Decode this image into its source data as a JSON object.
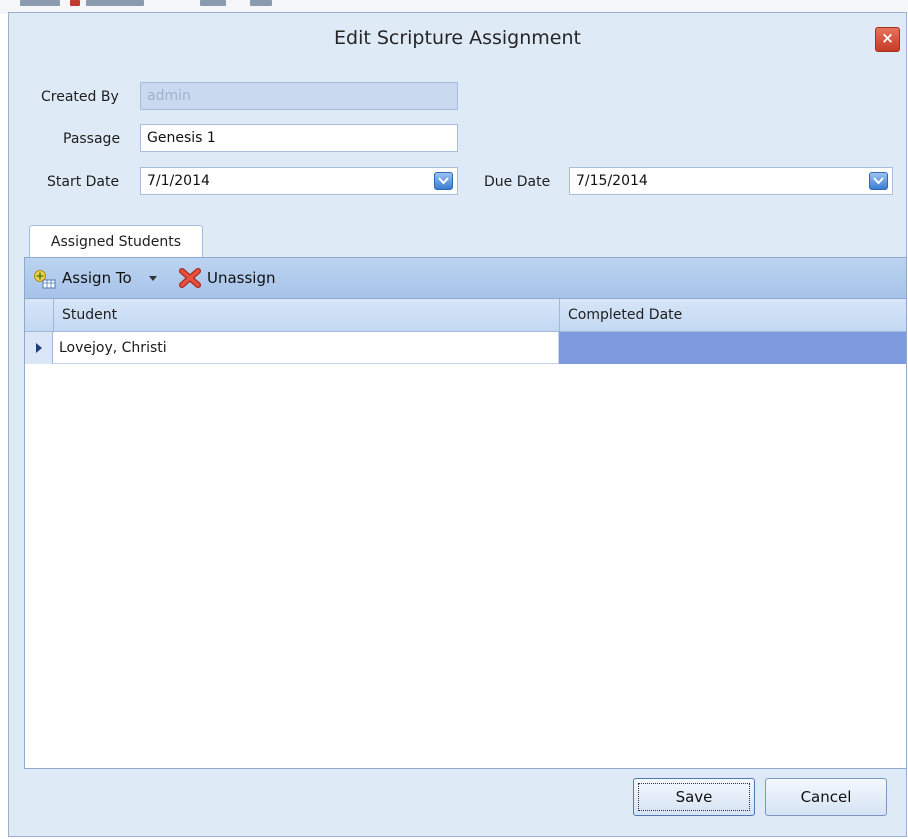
{
  "window": {
    "title": "Edit Scripture Assignment",
    "close_label": "×"
  },
  "form": {
    "created_by": {
      "label": "Created By",
      "value": "admin"
    },
    "passage": {
      "label": "Passage",
      "value": "Genesis 1"
    },
    "start_date": {
      "label": "Start Date",
      "value": "7/1/2014"
    },
    "due_date": {
      "label": "Due Date",
      "value": "7/15/2014"
    }
  },
  "tabs": [
    {
      "label": "Assigned Students",
      "active": true
    }
  ],
  "toolbar": {
    "assign_label": "Assign To",
    "unassign_label": "Unassign"
  },
  "grid": {
    "columns": [
      "Student",
      "Completed Date"
    ],
    "rows": [
      {
        "student": "Lovejoy, Christi",
        "completed_date": ""
      }
    ]
  },
  "buttons": {
    "save_label": "Save",
    "cancel_label": "Cancel"
  },
  "colors": {
    "dialog_bg": "#dfeaf7",
    "selected_cell": "#7f9be0",
    "close_button": "#d9533c",
    "header_bg": "#c3d8f2"
  }
}
